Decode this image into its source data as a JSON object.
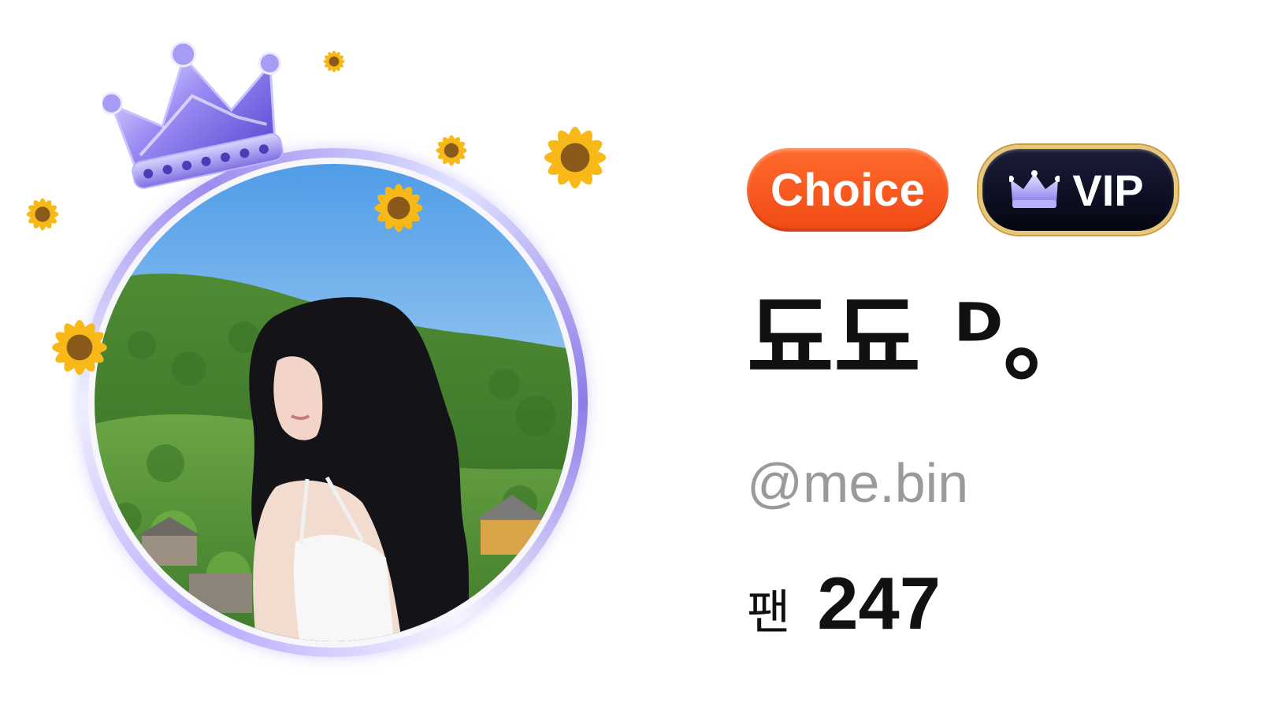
{
  "profile": {
    "badges": {
      "choice_label": "Choice",
      "vip_label": "VIP",
      "vip_icon": "crown-icon",
      "choice_color": "#f25418",
      "vip_bg_color": "#0d0e22",
      "vip_border_color": "#e7c77a"
    },
    "display_name": "됴됴 ᴰ。",
    "handle": "@me.bin",
    "fans": {
      "label": "팬",
      "count": "247"
    },
    "avatar": {
      "frame": "crown-sunflower-frame",
      "icons": [
        "crown-icon",
        "sunflower-icon"
      ]
    }
  }
}
